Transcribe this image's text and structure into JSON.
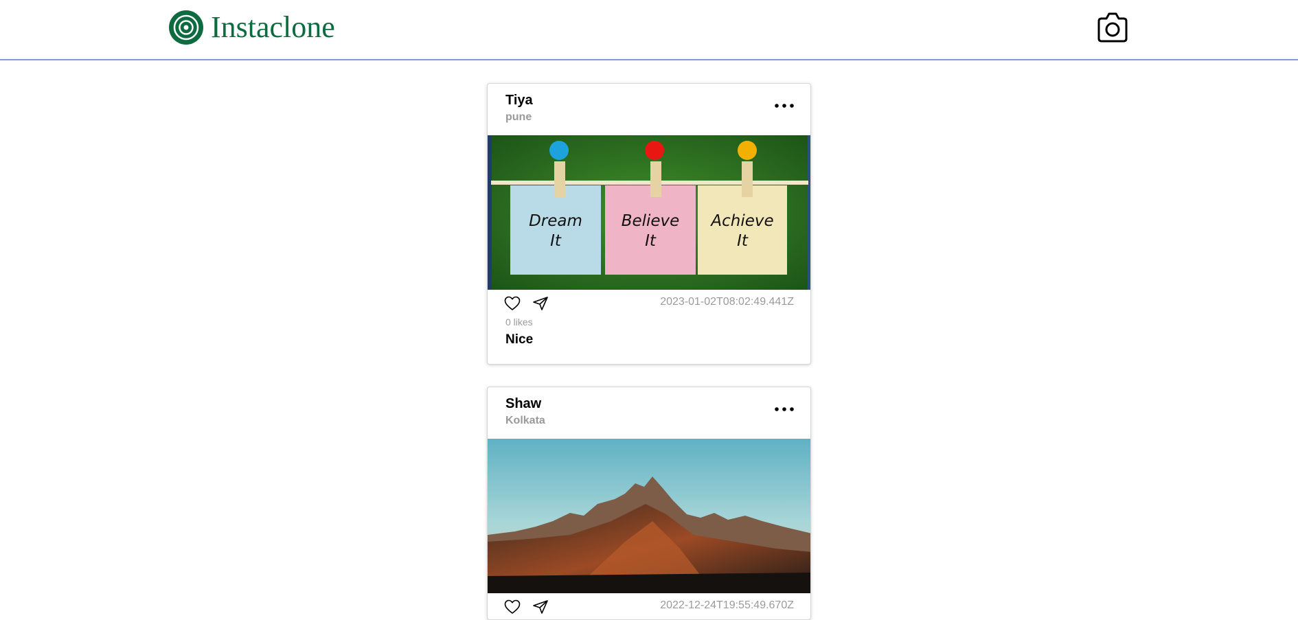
{
  "header": {
    "brand_name": "Instaclone",
    "logo_icon": "concentric-circle-logo-icon",
    "camera_icon": "camera-icon",
    "brand_color": "#0d6b3f",
    "divider_color": "#7b9fd6"
  },
  "posts": [
    {
      "author": "Tiya",
      "location": "pune",
      "image_alt": "sticky notes on clothesline",
      "image_notes": [
        {
          "line1": "Dream",
          "line2": "It"
        },
        {
          "line1": "Believe",
          "line2": "It"
        },
        {
          "line1": "Achieve",
          "line2": "It"
        }
      ],
      "timestamp": "2023-01-02T08:02:49.441Z",
      "likes": "0 likes",
      "caption": "Nice",
      "more_icon": "more-horizontal-icon",
      "like_icon": "heart-icon",
      "share_icon": "send-icon"
    },
    {
      "author": "Shaw",
      "location": "Kolkata",
      "image_alt": "mountain landscape",
      "timestamp": "2022-12-24T19:55:49.670Z",
      "more_icon": "more-horizontal-icon",
      "like_icon": "heart-icon",
      "share_icon": "send-icon"
    }
  ]
}
